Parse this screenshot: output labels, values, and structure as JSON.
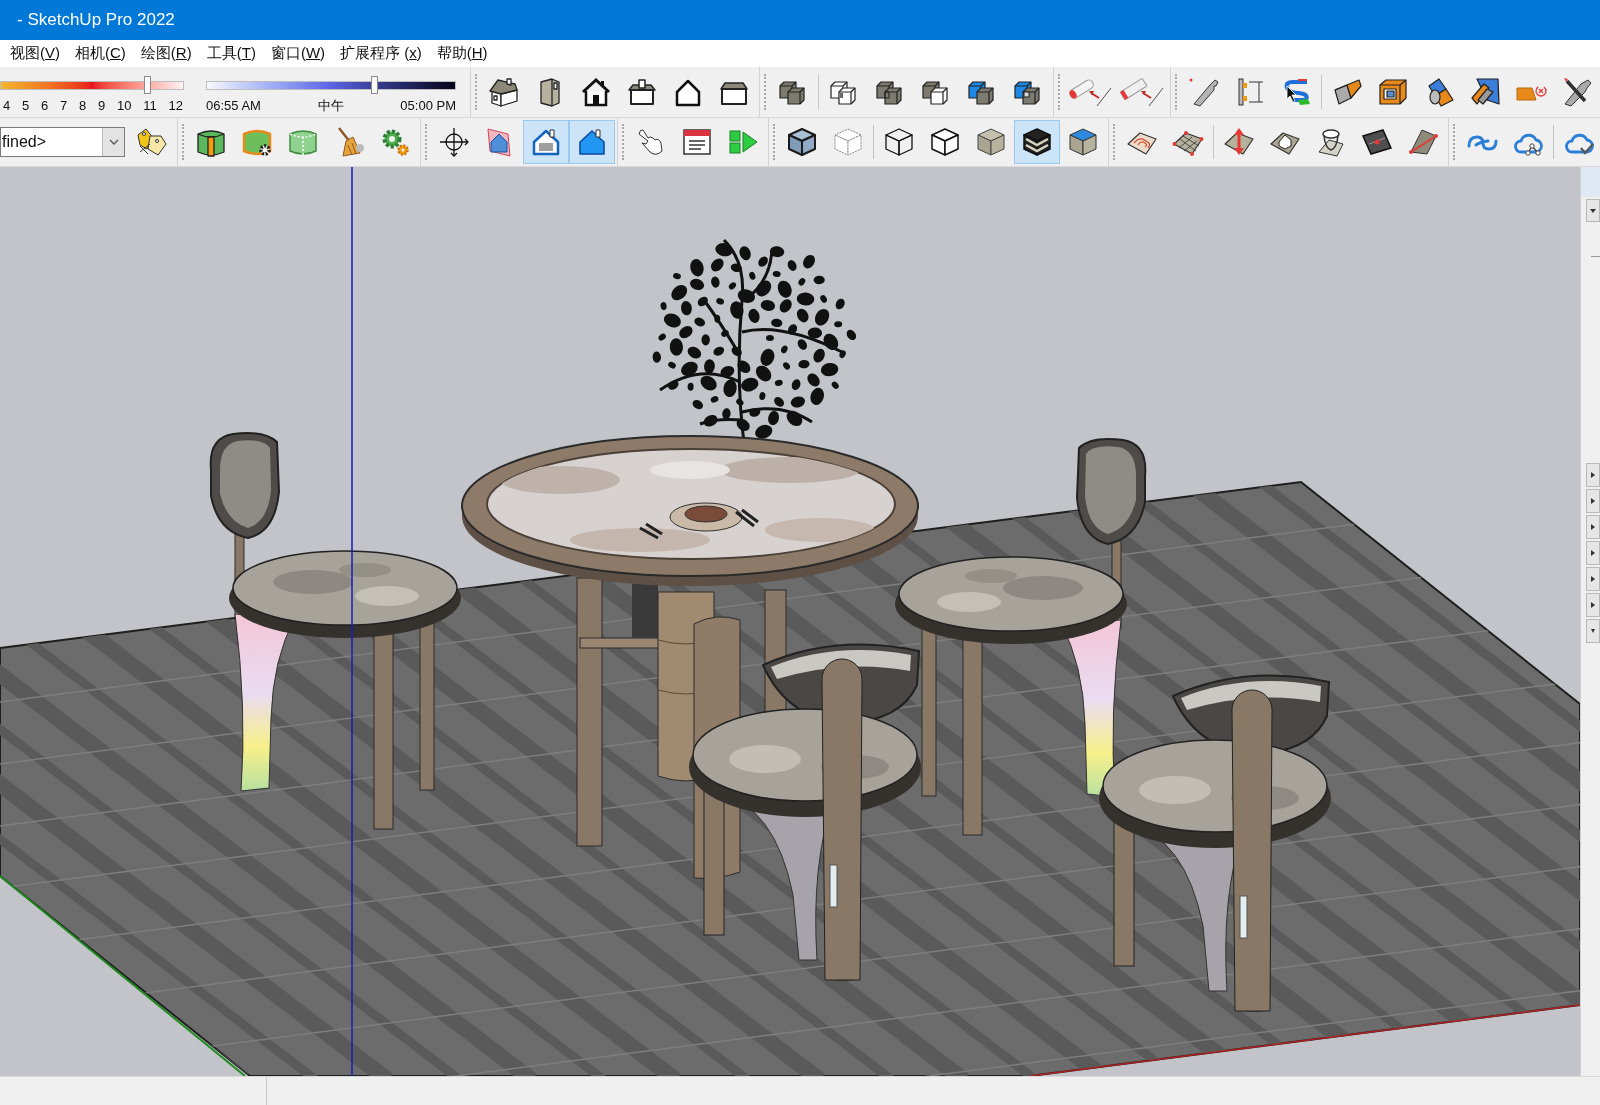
{
  "window": {
    "title": "- SketchUp Pro 2022"
  },
  "menu": [
    {
      "label": "视图(",
      "key": "V",
      "tail": ")"
    },
    {
      "label": "相机(",
      "key": "C",
      "tail": ")"
    },
    {
      "label": "绘图(",
      "key": "R",
      "tail": ")"
    },
    {
      "label": "工具(",
      "key": "T",
      "tail": ")"
    },
    {
      "label": "窗口(",
      "key": "W",
      "tail": ")"
    },
    {
      "label": "扩展程序 (",
      "key": "x",
      "tail": ")"
    },
    {
      "label": "帮助(",
      "key": "H",
      "tail": ")"
    }
  ],
  "toolbar_rows": [
    [
      {
        "kind": "shadow",
        "date_slider": {
          "ticks": [
            "4",
            "5",
            "6",
            "7",
            "8",
            "9",
            "10",
            "11",
            "12"
          ],
          "level": 0.8
        },
        "time_slider": {
          "labels": [
            "06:55 AM",
            "中午",
            "05:00 PM"
          ],
          "level": 0.67
        }
      },
      {
        "kind": "buttons",
        "sections": [
          [
            {
              "selected": false
            },
            {
              "selected": false
            },
            {
              "selected": false
            },
            {
              "selected": false
            },
            {
              "selected": false
            },
            {
              "selected": false
            }
          ]
        ]
      },
      {
        "kind": "buttons",
        "sections": [
          [
            {
              "selected": false
            }
          ],
          [
            {
              "selected": false
            },
            {
              "selected": false
            },
            {
              "selected": false
            },
            {
              "selected": false
            },
            {
              "selected": false
            }
          ]
        ]
      },
      {
        "kind": "buttons",
        "sections": [
          [
            {
              "selected": false
            },
            {
              "selected": false
            }
          ]
        ]
      },
      {
        "kind": "buttons",
        "sections": [
          [
            {
              "selected": false
            },
            {
              "selected": false
            },
            {
              "selected": false
            }
          ],
          [
            {
              "selected": false
            },
            {
              "selected": false
            },
            {
              "selected": false
            },
            {
              "selected": false
            },
            {
              "selected": false
            },
            {
              "selected": false
            }
          ]
        ]
      }
    ],
    [
      {
        "kind": "tag",
        "dropdown": {
          "value": "fined>"
        },
        "sections": [
          [
            {
              "selected": false
            }
          ]
        ]
      },
      {
        "kind": "buttons",
        "sections": [
          [
            {
              "selected": false
            },
            {
              "selected": false
            },
            {
              "selected": false
            },
            {
              "selected": false
            },
            {
              "selected": false
            }
          ]
        ]
      },
      {
        "kind": "buttons",
        "sections": [
          [
            {
              "selected": false
            },
            {
              "selected": false
            },
            {
              "selected": true
            },
            {
              "selected": true
            }
          ]
        ]
      },
      {
        "kind": "buttons",
        "sections": [
          [
            {
              "selected": false
            },
            {
              "selected": false
            },
            {
              "selected": false
            }
          ]
        ]
      },
      {
        "kind": "buttons",
        "sections": [
          [
            {
              "selected": false
            },
            {
              "selected": false
            }
          ],
          [
            {
              "selected": false
            },
            {
              "selected": false
            },
            {
              "selected": false
            },
            {
              "selected": true
            },
            {
              "selected": false
            }
          ]
        ]
      },
      {
        "kind": "buttons",
        "sections": [
          [
            {
              "selected": false
            },
            {
              "selected": false
            }
          ],
          [
            {
              "selected": false
            },
            {
              "selected": false
            },
            {
              "selected": false
            },
            {
              "selected": false
            },
            {
              "selected": false
            }
          ]
        ]
      },
      {
        "kind": "buttons",
        "sections": [
          [
            {
              "selected": false
            },
            {
              "selected": false
            }
          ],
          [
            {
              "selected": false
            }
          ]
        ]
      }
    ]
  ]
}
